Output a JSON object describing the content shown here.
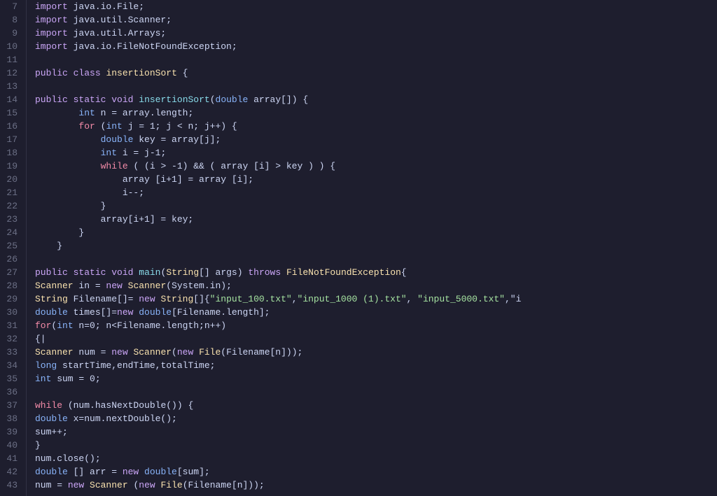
{
  "editor": {
    "background": "#1e1e2e",
    "lines": [
      {
        "num": "7",
        "tokens": [
          {
            "cls": "kw",
            "t": "import"
          },
          {
            "cls": "plain",
            "t": " java.io.File;"
          }
        ]
      },
      {
        "num": "8",
        "tokens": [
          {
            "cls": "kw",
            "t": "import"
          },
          {
            "cls": "plain",
            "t": " java.util.Scanner;"
          }
        ]
      },
      {
        "num": "9",
        "tokens": [
          {
            "cls": "kw",
            "t": "import"
          },
          {
            "cls": "plain",
            "t": " java.util.Arrays;"
          }
        ]
      },
      {
        "num": "10",
        "tokens": [
          {
            "cls": "kw",
            "t": "import"
          },
          {
            "cls": "plain",
            "t": " java.io.FileNotFoundException;"
          }
        ]
      },
      {
        "num": "11",
        "tokens": []
      },
      {
        "num": "12",
        "tokens": [
          {
            "cls": "kw",
            "t": "public"
          },
          {
            "cls": "plain",
            "t": " "
          },
          {
            "cls": "kw",
            "t": "class"
          },
          {
            "cls": "plain",
            "t": " "
          },
          {
            "cls": "class-name",
            "t": "insertionSort"
          },
          {
            "cls": "plain",
            "t": " {"
          }
        ]
      },
      {
        "num": "13",
        "tokens": []
      },
      {
        "num": "14",
        "tokens": [
          {
            "cls": "kw",
            "t": "public"
          },
          {
            "cls": "plain",
            "t": " "
          },
          {
            "cls": "kw",
            "t": "static"
          },
          {
            "cls": "plain",
            "t": " "
          },
          {
            "cls": "kw",
            "t": "void"
          },
          {
            "cls": "plain",
            "t": " "
          },
          {
            "cls": "fn",
            "t": "insertionSort"
          },
          {
            "cls": "plain",
            "t": "("
          },
          {
            "cls": "kw-blue",
            "t": "double"
          },
          {
            "cls": "plain",
            "t": " array[]) {"
          }
        ]
      },
      {
        "num": "15",
        "tokens": [
          {
            "cls": "plain",
            "t": "        "
          },
          {
            "cls": "kw-blue",
            "t": "int"
          },
          {
            "cls": "plain",
            "t": " n = array.length;"
          }
        ]
      },
      {
        "num": "16",
        "tokens": [
          {
            "cls": "plain",
            "t": "        "
          },
          {
            "cls": "kw-control",
            "t": "for"
          },
          {
            "cls": "plain",
            "t": " ("
          },
          {
            "cls": "kw-blue",
            "t": "int"
          },
          {
            "cls": "plain",
            "t": " j = 1; j < n; j++) {"
          }
        ]
      },
      {
        "num": "17",
        "tokens": [
          {
            "cls": "plain",
            "t": "            "
          },
          {
            "cls": "kw-blue",
            "t": "double"
          },
          {
            "cls": "plain",
            "t": " key = array[j];"
          }
        ]
      },
      {
        "num": "18",
        "tokens": [
          {
            "cls": "plain",
            "t": "            "
          },
          {
            "cls": "kw-blue",
            "t": "int"
          },
          {
            "cls": "plain",
            "t": " i = j-1;"
          }
        ]
      },
      {
        "num": "19",
        "tokens": [
          {
            "cls": "plain",
            "t": "            "
          },
          {
            "cls": "kw-control",
            "t": "while"
          },
          {
            "cls": "plain",
            "t": " ( (i > -1) && ( array [i] > key ) ) {"
          }
        ]
      },
      {
        "num": "20",
        "tokens": [
          {
            "cls": "plain",
            "t": "                array [i+1] = array [i];"
          }
        ]
      },
      {
        "num": "21",
        "tokens": [
          {
            "cls": "plain",
            "t": "                i--;"
          }
        ]
      },
      {
        "num": "22",
        "tokens": [
          {
            "cls": "plain",
            "t": "            }"
          }
        ]
      },
      {
        "num": "23",
        "tokens": [
          {
            "cls": "plain",
            "t": "            array[i+1] = key;"
          }
        ]
      },
      {
        "num": "24",
        "tokens": [
          {
            "cls": "plain",
            "t": "        }"
          }
        ]
      },
      {
        "num": "25",
        "tokens": [
          {
            "cls": "plain",
            "t": "    }"
          }
        ]
      },
      {
        "num": "26",
        "tokens": []
      },
      {
        "num": "27",
        "tokens": [
          {
            "cls": "kw",
            "t": "public"
          },
          {
            "cls": "plain",
            "t": " "
          },
          {
            "cls": "kw",
            "t": "static"
          },
          {
            "cls": "plain",
            "t": " "
          },
          {
            "cls": "kw",
            "t": "void"
          },
          {
            "cls": "plain",
            "t": " "
          },
          {
            "cls": "fn",
            "t": "main"
          },
          {
            "cls": "plain",
            "t": "("
          },
          {
            "cls": "class-name",
            "t": "String"
          },
          {
            "cls": "plain",
            "t": "[] args) "
          },
          {
            "cls": "throws-kw",
            "t": "throws"
          },
          {
            "cls": "plain",
            "t": " "
          },
          {
            "cls": "class-name",
            "t": "FileNotFoundException"
          },
          {
            "cls": "plain",
            "t": "{"
          }
        ]
      },
      {
        "num": "28",
        "tokens": [
          {
            "cls": "class-name",
            "t": "Scanner"
          },
          {
            "cls": "plain",
            "t": " in = "
          },
          {
            "cls": "kw",
            "t": "new"
          },
          {
            "cls": "plain",
            "t": " "
          },
          {
            "cls": "class-name",
            "t": "Scanner"
          },
          {
            "cls": "plain",
            "t": "(System.in);"
          }
        ]
      },
      {
        "num": "29",
        "tokens": [
          {
            "cls": "class-name",
            "t": "String"
          },
          {
            "cls": "plain",
            "t": " Filename[]= "
          },
          {
            "cls": "kw",
            "t": "new"
          },
          {
            "cls": "plain",
            "t": " "
          },
          {
            "cls": "class-name",
            "t": "String"
          },
          {
            "cls": "plain",
            "t": "[]{"
          },
          {
            "cls": "str",
            "t": "\"input_100.txt\""
          },
          {
            "cls": "plain",
            "t": ","
          },
          {
            "cls": "str",
            "t": "\"input_1000 (1).txt\""
          },
          {
            "cls": "plain",
            "t": ", "
          },
          {
            "cls": "str",
            "t": "\"input_5000.txt\""
          },
          {
            "cls": "plain",
            "t": ",\"i"
          }
        ]
      },
      {
        "num": "30",
        "tokens": [
          {
            "cls": "kw-blue",
            "t": "double"
          },
          {
            "cls": "plain",
            "t": " times[]="
          },
          {
            "cls": "kw",
            "t": "new"
          },
          {
            "cls": "plain",
            "t": " "
          },
          {
            "cls": "kw-blue",
            "t": "double"
          },
          {
            "cls": "plain",
            "t": "[Filename.length];"
          }
        ]
      },
      {
        "num": "31",
        "tokens": [
          {
            "cls": "kw-control",
            "t": "for"
          },
          {
            "cls": "plain",
            "t": "("
          },
          {
            "cls": "kw-blue",
            "t": "int"
          },
          {
            "cls": "plain",
            "t": " n=0; n<Filename.length;n++)"
          }
        ]
      },
      {
        "num": "32",
        "tokens": [
          {
            "cls": "plain",
            "t": "{|"
          }
        ]
      },
      {
        "num": "33",
        "tokens": [
          {
            "cls": "class-name",
            "t": "Scanner"
          },
          {
            "cls": "plain",
            "t": " num = "
          },
          {
            "cls": "kw",
            "t": "new"
          },
          {
            "cls": "plain",
            "t": " "
          },
          {
            "cls": "class-name",
            "t": "Scanner"
          },
          {
            "cls": "plain",
            "t": "("
          },
          {
            "cls": "kw",
            "t": "new"
          },
          {
            "cls": "plain",
            "t": " "
          },
          {
            "cls": "class-name",
            "t": "File"
          },
          {
            "cls": "plain",
            "t": "(Filename[n]));"
          }
        ]
      },
      {
        "num": "34",
        "tokens": [
          {
            "cls": "kw-blue",
            "t": "long"
          },
          {
            "cls": "plain",
            "t": " startTime,endTime,totalTime;"
          }
        ]
      },
      {
        "num": "35",
        "tokens": [
          {
            "cls": "kw-blue",
            "t": "int"
          },
          {
            "cls": "plain",
            "t": " sum = 0;"
          }
        ]
      },
      {
        "num": "36",
        "tokens": []
      },
      {
        "num": "37",
        "tokens": [
          {
            "cls": "kw-control",
            "t": "while"
          },
          {
            "cls": "plain",
            "t": " (num.hasNextDouble()) {"
          }
        ]
      },
      {
        "num": "38",
        "tokens": [
          {
            "cls": "kw-blue",
            "t": "double"
          },
          {
            "cls": "plain",
            "t": " x=num.nextDouble();"
          }
        ]
      },
      {
        "num": "39",
        "tokens": [
          {
            "cls": "plain",
            "t": "sum++;"
          }
        ]
      },
      {
        "num": "40",
        "tokens": [
          {
            "cls": "plain",
            "t": "}"
          }
        ]
      },
      {
        "num": "41",
        "tokens": [
          {
            "cls": "plain",
            "t": "num.close();"
          }
        ]
      },
      {
        "num": "42",
        "tokens": [
          {
            "cls": "kw-blue",
            "t": "double"
          },
          {
            "cls": "plain",
            "t": " [] arr = "
          },
          {
            "cls": "kw",
            "t": "new"
          },
          {
            "cls": "plain",
            "t": " "
          },
          {
            "cls": "kw-blue",
            "t": "double"
          },
          {
            "cls": "plain",
            "t": "[sum];"
          }
        ]
      },
      {
        "num": "43",
        "tokens": [
          {
            "cls": "plain",
            "t": "num = "
          },
          {
            "cls": "kw",
            "t": "new"
          },
          {
            "cls": "plain",
            "t": " "
          },
          {
            "cls": "class-name",
            "t": "Scanner"
          },
          {
            "cls": "plain",
            "t": " ("
          },
          {
            "cls": "kw",
            "t": "new"
          },
          {
            "cls": "plain",
            "t": " "
          },
          {
            "cls": "class-name",
            "t": "File"
          },
          {
            "cls": "plain",
            "t": "(Filename[n]));"
          }
        ]
      }
    ]
  }
}
